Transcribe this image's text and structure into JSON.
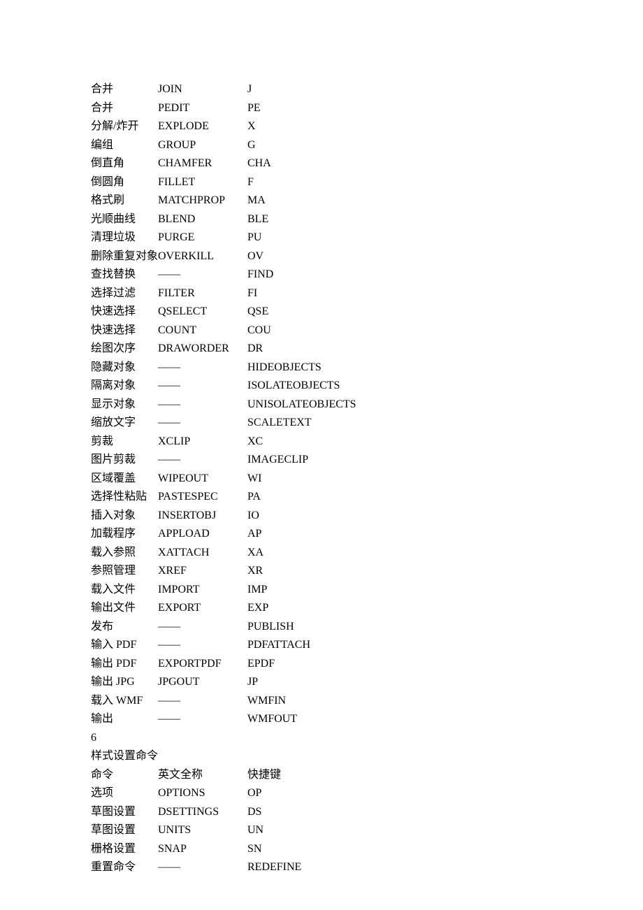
{
  "table1": [
    {
      "c1": "合并",
      "c2": "JOIN",
      "c3": "J"
    },
    {
      "c1": "合并",
      "c2": "PEDIT",
      "c3": "PE"
    },
    {
      "c1": "分解/炸开",
      "c2": "EXPLODE",
      "c3": "X"
    },
    {
      "c1": "编组",
      "c2": "GROUP",
      "c3": "G"
    },
    {
      "c1": "倒直角",
      "c2": "CHAMFER",
      "c3": "CHA"
    },
    {
      "c1": "倒圆角",
      "c2": "FILLET",
      "c3": "F"
    },
    {
      "c1": "格式刷",
      "c2": "MATCHPROP",
      "c3": "MA"
    },
    {
      "c1": "光顺曲线",
      "c2": "BLEND",
      "c3": "BLE"
    },
    {
      "c1": "清理垃圾",
      "c2": "PURGE",
      "c3": "PU"
    },
    {
      "c1": "删除重复对象",
      "c2": "OVERKILL",
      "c3": "OV",
      "merge12": true
    },
    {
      "c1": "查找替换",
      "c2": "——",
      "c3": "FIND"
    },
    {
      "c1": "选择过滤",
      "c2": "FILTER",
      "c3": "FI"
    },
    {
      "c1": "快速选择",
      "c2": "QSELECT",
      "c3": "QSE"
    },
    {
      "c1": "快速选择",
      "c2": "COUNT",
      "c3": "COU"
    },
    {
      "c1": "绘图次序",
      "c2": "DRAWORDER",
      "c3": "DR"
    },
    {
      "c1": "隐藏对象",
      "c2": "——",
      "c3": "HIDEOBJECTS"
    },
    {
      "c1": "隔离对象",
      "c2": "——",
      "c3": "ISOLATEOBJECTS"
    },
    {
      "c1": "显示对象",
      "c2": "——",
      "c3": "UNISOLATEOBJECTS",
      "tall": true
    },
    {
      "c1": "缩放文字",
      "c2": "——",
      "c3": "SCALETEXT"
    },
    {
      "c1": "剪裁",
      "c2": "XCLIP",
      "c3": "XC"
    },
    {
      "c1": "图片剪裁",
      "c2": "——",
      "c3": "IMAGECLIP"
    },
    {
      "c1": "区域覆盖",
      "c2": "WIPEOUT",
      "c3": "WI"
    },
    {
      "c1": "选择性粘贴",
      "c2": "PASTESPEC",
      "c3": "PA"
    },
    {
      "c1": "插入对象",
      "c2": "INSERTOBJ",
      "c3": "IO"
    },
    {
      "c1": "加载程序",
      "c2": "APPLOAD",
      "c3": "AP"
    },
    {
      "c1": "载入参照",
      "c2": "XATTACH",
      "c3": "XA"
    },
    {
      "c1": "参照管理",
      "c2": "XREF",
      "c3": "XR"
    },
    {
      "c1": "载入文件",
      "c2": "IMPORT",
      "c3": "IMP"
    },
    {
      "c1": "输出文件",
      "c2": "EXPORT",
      "c3": "EXP"
    },
    {
      "c1": "发布",
      "c2": "——",
      "c3": "PUBLISH"
    },
    {
      "c1": "输入 PDF",
      "c2": "——",
      "c3": "PDFATTACH"
    },
    {
      "c1": "输出 PDF",
      "c2": "EXPORTPDF",
      "c3": "EPDF"
    },
    {
      "c1": "输出 JPG",
      "c2": "JPGOUT",
      "c3": "JP"
    },
    {
      "c1": "载入 WMF",
      "c2": "——",
      "c3": "WMFIN"
    },
    {
      "c1": "输出",
      "c2": "——",
      "c3": "WMFOUT"
    }
  ],
  "section": {
    "num": "6",
    "title": "样式设置命令"
  },
  "table2_header": {
    "c1": "命令",
    "c2": "英文全称",
    "c3": "快捷键"
  },
  "table2": [
    {
      "c1": "选项",
      "c2": "OPTIONS",
      "c3": "OP"
    },
    {
      "c1": "草图设置",
      "c2": "DSETTINGS",
      "c3": "DS"
    },
    {
      "c1": "草图设置",
      "c2": "UNITS",
      "c3": "UN"
    },
    {
      "c1": "栅格设置",
      "c2": "SNAP",
      "c3": "SN"
    },
    {
      "c1": "重置命令",
      "c2": "——",
      "c3": "REDEFINE"
    }
  ]
}
